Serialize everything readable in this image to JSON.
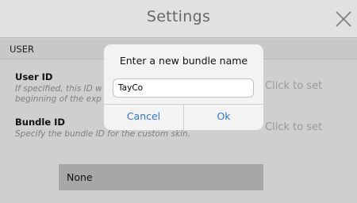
{
  "header": {
    "title": "Settings",
    "close_icon": "close-icon"
  },
  "section": {
    "label": "USER"
  },
  "rows": [
    {
      "label": "User ID",
      "description_line1": "If specified, this ID w",
      "description_line2": "beginning of the exp",
      "action": "Click to set"
    },
    {
      "label": "Bundle ID",
      "description": "Specify the bundle ID for the custom skin.",
      "action": "Click to set"
    }
  ],
  "skin_option": {
    "label": "None"
  },
  "dialog": {
    "title": "Enter a new bundle name",
    "input_value": "TayCo",
    "cancel_label": "Cancel",
    "ok_label": "Ok",
    "accent_color": "#2b79d6"
  }
}
